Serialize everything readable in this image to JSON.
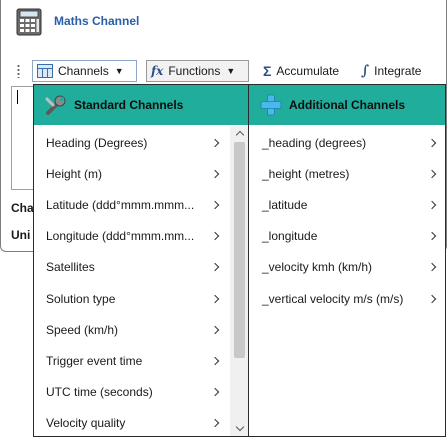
{
  "window": {
    "title": "Maths Channel"
  },
  "toolbar": {
    "channels_label": "Channels",
    "functions_label": "Functions",
    "accumulate_label": "Accumulate",
    "integrate_label": "Integrate"
  },
  "form": {
    "channel_label": "Cha",
    "units_label": "Uni"
  },
  "standard": {
    "title": "Standard Channels",
    "items": [
      {
        "label": "Heading (Degrees)"
      },
      {
        "label": "Height (m)"
      },
      {
        "label": "Latitude (ddd°mmm.mmm..."
      },
      {
        "label": "Longitude (ddd°mmm.mm..."
      },
      {
        "label": "Satellites"
      },
      {
        "label": "Solution type"
      },
      {
        "label": "Speed (km/h)"
      },
      {
        "label": "Trigger event time"
      },
      {
        "label": "UTC time (seconds)"
      },
      {
        "label": "Velocity quality"
      }
    ]
  },
  "additional": {
    "title": "Additional Channels",
    "items": [
      {
        "label": "_heading (degrees)"
      },
      {
        "label": "_height (metres)"
      },
      {
        "label": "_latitude"
      },
      {
        "label": "_longitude"
      },
      {
        "label": "_velocity kmh (km/h)"
      },
      {
        "label": "_vertical velocity m/s (m/s)"
      }
    ]
  },
  "icons": {
    "app": "calculator-icon",
    "channels": "channels-icon",
    "functions": "fx-icon",
    "accumulate": "sigma-icon",
    "integrate": "integral-icon",
    "standard": "wrench-icon",
    "additional": "plus-icon"
  },
  "colors": {
    "panel_header": "#21ad9b",
    "title_text": "#2a5ea8"
  }
}
